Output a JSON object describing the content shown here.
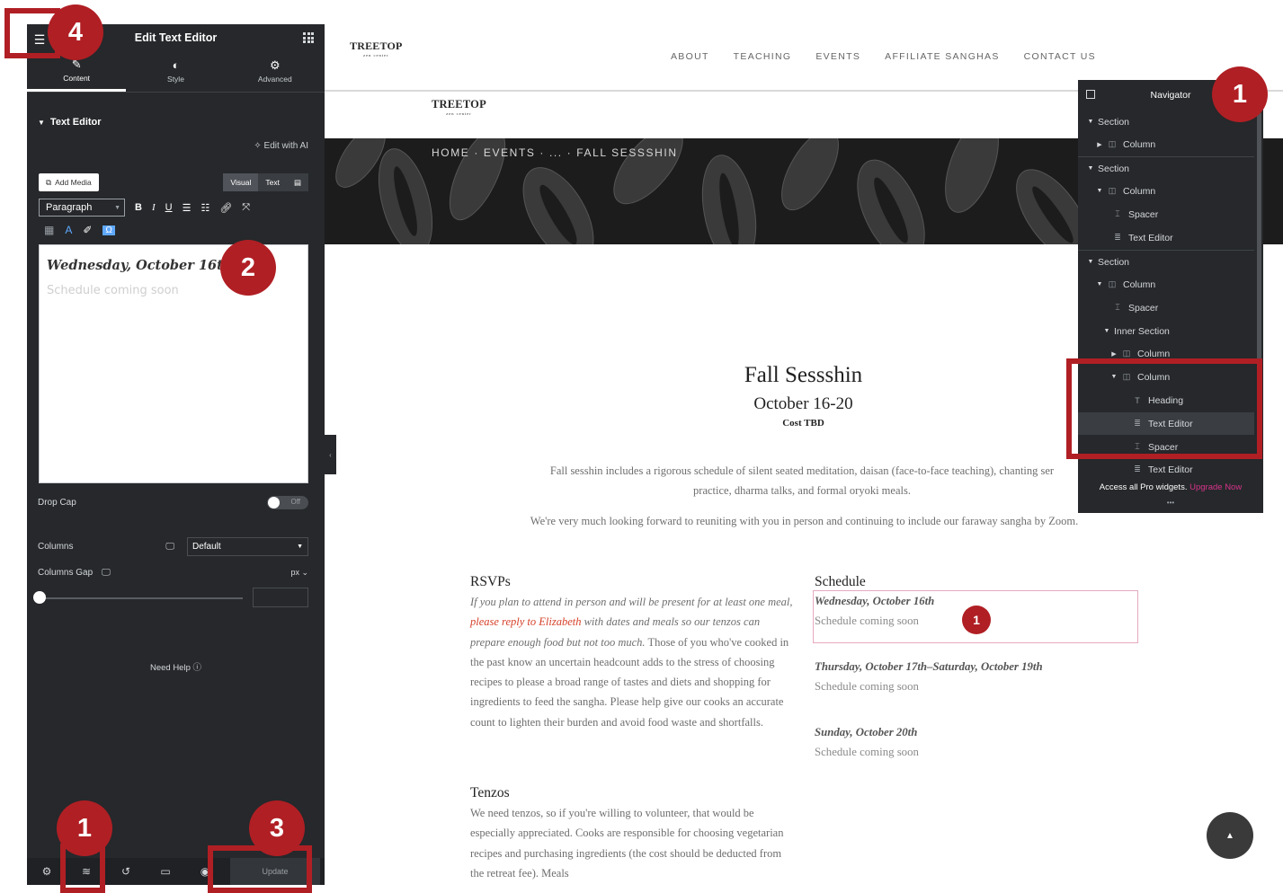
{
  "editor": {
    "title": "Edit Text Editor",
    "tabs": [
      {
        "label": "Content",
        "icon": "pencil-icon"
      },
      {
        "label": "Style",
        "icon": "half-circle-icon"
      },
      {
        "label": "Advanced",
        "icon": "gear-icon"
      }
    ],
    "section_label": "Text Editor",
    "edit_with_ai": "Edit with AI",
    "add_media": "Add Media",
    "visual_tab": "Visual",
    "text_tab": "Text",
    "paragraph_select": "Paragraph",
    "content_line1": "Wednesday, October 16th",
    "content_line2": "Schedule coming soon",
    "drop_cap_label": "Drop Cap",
    "drop_cap_state": "Off",
    "columns_label": "Columns",
    "columns_value": "Default",
    "columns_gap_label": "Columns Gap",
    "columns_gap_unit": "px",
    "need_help": "Need Help",
    "update_button": "Update"
  },
  "site": {
    "logo": "TREETOP",
    "logo_sub": "zen center",
    "nav": [
      "ABOUT",
      "TEACHING",
      "EVENTS",
      "AFFILIATE SANGHAS",
      "CONTACT US"
    ],
    "breadcrumb": "HOME · EVENTS · ... · FALL SESSSHIN",
    "event_title": "Fall Sessshin",
    "event_dates": "October 16-20",
    "event_cost": "Cost TBD",
    "intro_p1_line1": "Fall sesshin includes a rigorous schedule of silent seated meditation, daisan (face-to-face teaching), chanting ser",
    "intro_p1_line2": "practice, dharma talks, and formal oryoki meals.",
    "intro_p2": "We're very much looking forward to reuniting with you in person and continuing to include our faraway sangha by Zoom.",
    "rsvps_heading": "RSVPs",
    "rsvps_text_a": "If you plan to attend in person and will be present for at least one meal, ",
    "rsvps_link": "please reply to Elizabeth",
    "rsvps_text_b": " with dates and meals so our tenzos can prepare enough food but not too much.",
    "rsvps_text_c": " Those of you who've cooked in the past know an uncertain headcount adds to the stress of choosing recipes to please a broad range of tastes and diets and shopping for ingredients to feed the sangha. Please help give our cooks an accurate count to lighten their burden and avoid food waste and shortfalls.",
    "tenzos_heading": "Tenzos",
    "tenzos_text": "We need tenzos, so if you're willing to volunteer, that would be especially appreciated. Cooks are responsible for choosing vegetarian recipes and purchasing ingredients (the cost should be deducted from the retreat fee). Meals",
    "schedule_heading": "Schedule",
    "schedule": [
      {
        "day": "Wednesday, October 16th",
        "note": "Schedule coming soon"
      },
      {
        "day": "Thursday, October 17th–Saturday, October 19th",
        "note": "Schedule coming soon"
      },
      {
        "day": "Sunday, October 20th",
        "note": "Schedule coming soon"
      }
    ]
  },
  "navigator": {
    "title": "Navigator",
    "items": [
      {
        "label": "Section",
        "icon": "caret-down-icon"
      },
      {
        "label": "Column",
        "icon": "column-icon"
      },
      {
        "label": "Section",
        "icon": "caret-down-icon"
      },
      {
        "label": "Column",
        "icon": "column-icon"
      },
      {
        "label": "Spacer",
        "icon": "spacer-icon"
      },
      {
        "label": "Text Editor",
        "icon": "text-editor-icon"
      },
      {
        "label": "Section",
        "icon": "caret-down-icon"
      },
      {
        "label": "Column",
        "icon": "column-icon"
      },
      {
        "label": "Spacer",
        "icon": "spacer-icon"
      },
      {
        "label": "Inner Section",
        "icon": "caret-down-icon"
      },
      {
        "label": "Column",
        "icon": "column-icon"
      },
      {
        "label": "Column",
        "icon": "column-icon"
      },
      {
        "label": "Heading",
        "icon": "heading-icon"
      },
      {
        "label": "Text Editor",
        "icon": "text-editor-icon"
      },
      {
        "label": "Spacer",
        "icon": "spacer-icon"
      },
      {
        "label": "Text Editor",
        "icon": "text-editor-icon"
      }
    ],
    "pro_text": "Access all Pro widgets.",
    "pro_link": "Upgrade Now"
  },
  "annotations": {
    "badge_navigator": "1",
    "badge_editor": "2",
    "badge_update": "3",
    "badge_menu": "4",
    "badge_footer": "1",
    "badge_preview": "1",
    "color": "#b01f24"
  }
}
